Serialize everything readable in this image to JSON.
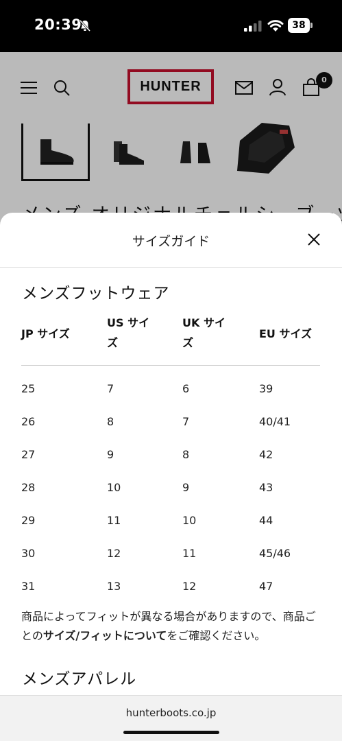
{
  "status_bar": {
    "time": "20:39",
    "battery": "38"
  },
  "header": {
    "logo": "HUNTER",
    "cart_count": "0"
  },
  "product": {
    "title_partial": "メンズ オリジナルチェルシーブーツ"
  },
  "size_guide": {
    "title": "サイズガイド",
    "footwear_title": "メンズフットウェア",
    "columns": [
      "JP サイズ",
      "US サイ\nズ",
      "UK サイ\nズ",
      "EU サイズ"
    ],
    "rows": [
      [
        "25",
        "7",
        "6",
        "39"
      ],
      [
        "26",
        "8",
        "7",
        "40/41"
      ],
      [
        "27",
        "9",
        "8",
        "42"
      ],
      [
        "28",
        "10",
        "9",
        "43"
      ],
      [
        "29",
        "11",
        "10",
        "44"
      ],
      [
        "30",
        "12",
        "11",
        "45/46"
      ],
      [
        "31",
        "13",
        "12",
        "47"
      ]
    ],
    "note_part1": "商品によってフィットが異なる場合がありますので、商品ごとの",
    "note_bold": "サイズ/フィットについて",
    "note_part2": "をご確認ください。",
    "apparel_title": "メンズアパレル"
  },
  "browser": {
    "url": "hunterboots.co.jp"
  }
}
